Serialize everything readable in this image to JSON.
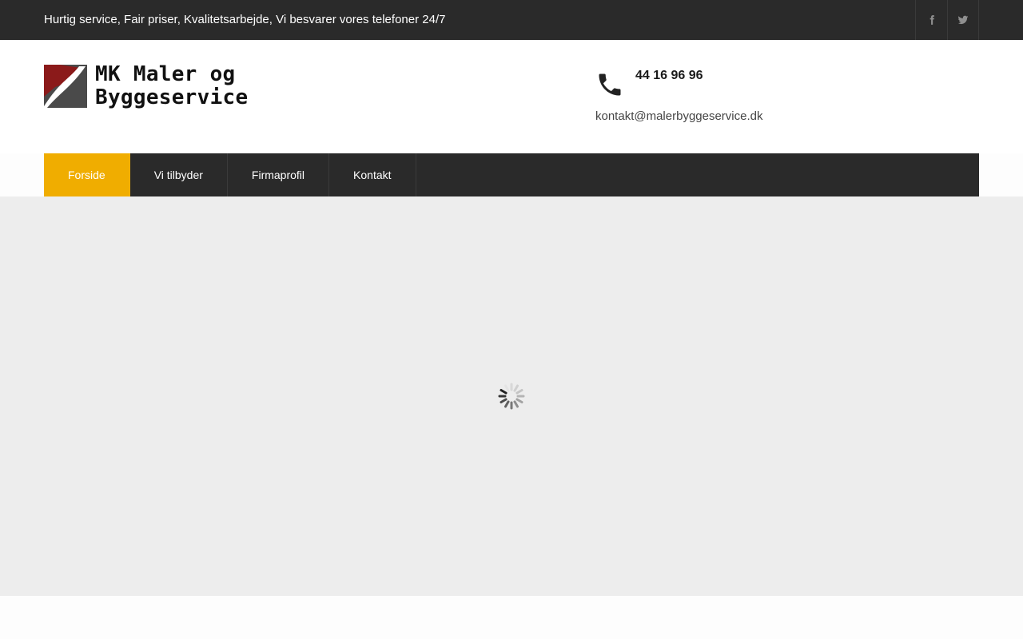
{
  "topbar": {
    "tagline": "Hurtig service, Fair priser, Kvalitetsarbejde, Vi besvarer vores telefoner 24/7",
    "social": [
      {
        "icon": "facebook-icon"
      },
      {
        "icon": "twitter-icon"
      }
    ]
  },
  "header": {
    "logo_line1": "MK Maler og",
    "logo_line2": "Byggeservice",
    "phone": "44 16 96 96",
    "email": "kontakt@malerbyggeservice.dk"
  },
  "nav": {
    "items": [
      {
        "label": "Forside",
        "active": true
      },
      {
        "label": "Vi tilbyder",
        "active": false
      },
      {
        "label": "Firmaprofil",
        "active": false
      },
      {
        "label": "Kontakt",
        "active": false
      }
    ]
  },
  "slider": {
    "state": "loading",
    "icon": "loading-spinner-icon"
  },
  "colors": {
    "topbar_bg": "#2a2a2a",
    "nav_active": "#f0ad00",
    "slider_bg": "#ededed",
    "logo_red": "#8b1a1a"
  }
}
